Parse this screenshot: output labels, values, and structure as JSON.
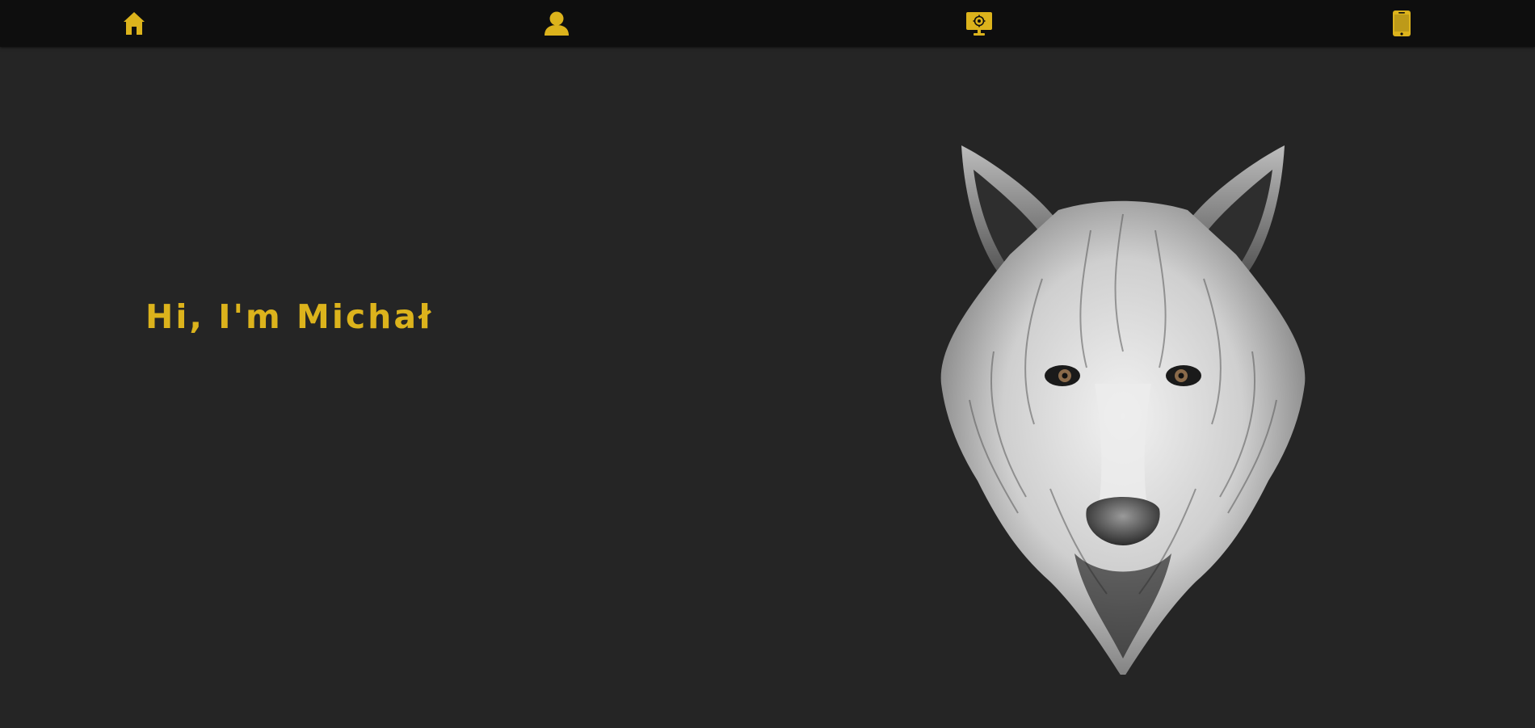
{
  "nav": {
    "accent_color": "#dcb31c",
    "items": [
      {
        "icon": "home-icon"
      },
      {
        "icon": "user-icon"
      },
      {
        "icon": "monitor-settings-icon"
      },
      {
        "icon": "phone-icon"
      }
    ]
  },
  "hero": {
    "greeting": "Hi, I'm Michał"
  },
  "colors": {
    "background": "#252525",
    "navbar": "#0e0e0e",
    "accent": "#dcb31c"
  }
}
